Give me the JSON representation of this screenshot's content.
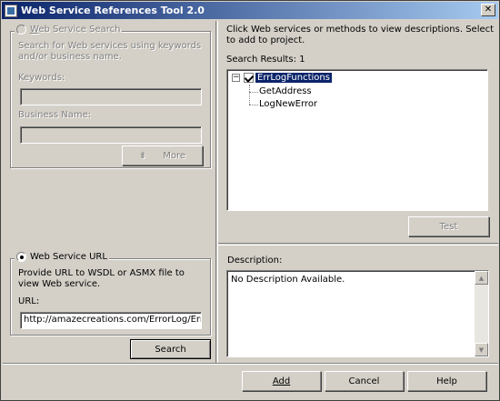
{
  "window": {
    "title": "Web Service References Tool 2.0",
    "close_glyph": "✕"
  },
  "search_group": {
    "title": "Web Service Search",
    "description": "Search for Web services using keywords and/or business name.",
    "keywords_label": "Keywords:",
    "business_label": "Business Name:",
    "more_label": "More",
    "more_glyph": "⇟"
  },
  "url_group": {
    "title": "Web Service URL",
    "description": "Provide URL to WSDL or ASMX file to view Web service.",
    "url_label": "URL:",
    "url_value": "http://amazecreations.com/ErrorLog/ErrLogFu"
  },
  "search_button": "Search",
  "right": {
    "instructions": "Click Web services or methods to view descriptions. Select to add to project.",
    "results_label": "Search Results: 1",
    "tree": {
      "root": "ErrLogFunctions",
      "root_expander": "−",
      "children": [
        "GetAddress",
        "LogNewError"
      ]
    },
    "test_label": "Test",
    "description_label": "Description:",
    "description_text": "No Description Available."
  },
  "footer": {
    "add": "Add",
    "cancel": "Cancel",
    "help": "Help"
  },
  "icons": {
    "scroll_up": "▲",
    "scroll_down": "▼"
  }
}
